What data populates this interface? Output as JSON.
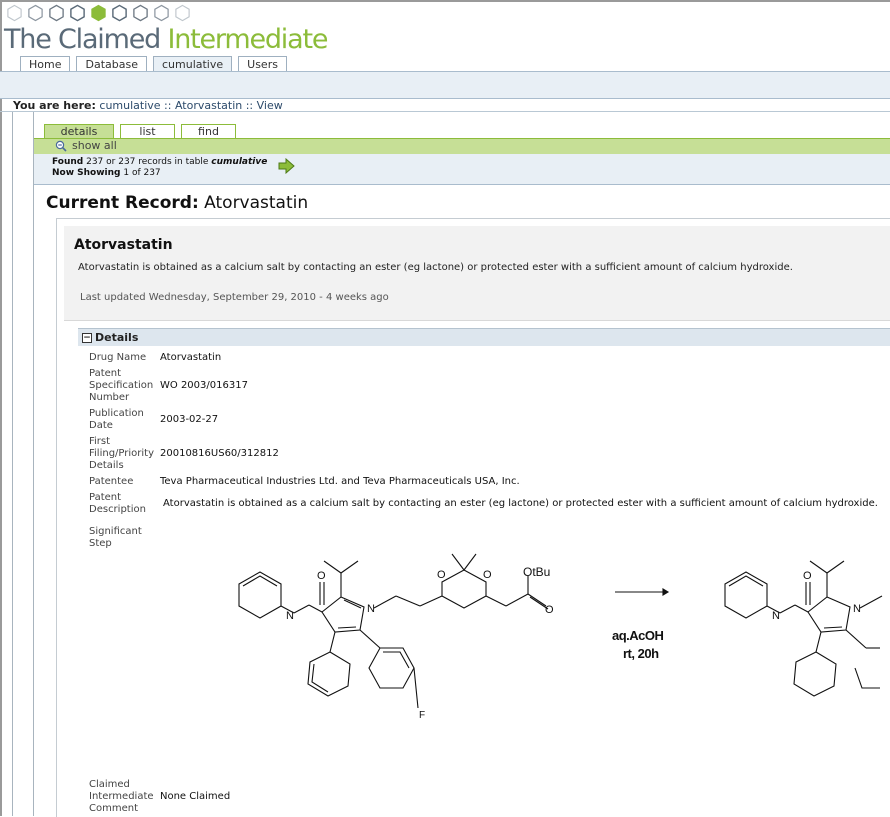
{
  "brand": {
    "part1": "The Claimed",
    "part2": "Intermediate"
  },
  "nav": {
    "tabs": [
      "Home",
      "Database",
      "cumulative",
      "Users"
    ],
    "active_index": 2
  },
  "breadcrumb": {
    "prefix": "You are here:",
    "path": "cumulative :: Atorvastatin :: View"
  },
  "subtabs": [
    "details",
    "list",
    "find"
  ],
  "show_all": "show all",
  "found": {
    "line1_a": "Found",
    "line1_b": "237 or 237 records in table",
    "table": "cumulative",
    "line2_a": "Now Showing",
    "line2_b": "1 of 237"
  },
  "current_record": {
    "prefix": "Current Record:",
    "name": "Atorvastatin"
  },
  "summary": {
    "title": "Atorvastatin",
    "description": "Atorvastatin is obtained as a calcium salt by contacting an ester (eg lactone) or protected ester with a sufficient amount of calcium hydroxide.",
    "updated": "Last updated Wednesday, September 29, 2010 - 4 weeks ago"
  },
  "details": {
    "section_label": "Details",
    "drug_name_label": "Drug Name",
    "drug_name": "Atorvastatin",
    "patent_label": "Patent Specification Number",
    "patent": "WO 2003/016317",
    "pub_label": "Publication Date",
    "pub": "2003-02-27",
    "filing_label": "First Filing/Priority Details",
    "filing": "20010816US60/312812",
    "patentee_label": "Patentee",
    "patentee": "Teva Pharmaceutical Industries Ltd. and Teva Pharmaceuticals USA, Inc.",
    "desc_label": "Patent Description",
    "desc": "Atorvastatin is obtained as a calcium salt by contacting an ester (eg lactone) or protected ester with a sufficient amount of calcium hydroxide.",
    "step_label": "Significant Step",
    "claimed_label": "Claimed Intermediate Comment",
    "claimed": "None Claimed"
  },
  "scheme": {
    "ester_group": "OtBu",
    "atom_N": "N",
    "atom_O": "O",
    "atom_F": "F",
    "conditions_1": "aq.AcOH",
    "conditions_2": "rt, 20h"
  },
  "colors": {
    "brand_grey": "#5a6a78",
    "brand_green": "#8cbc3a",
    "tab_green": "#c6df96",
    "band_blue": "#e8eff5"
  }
}
